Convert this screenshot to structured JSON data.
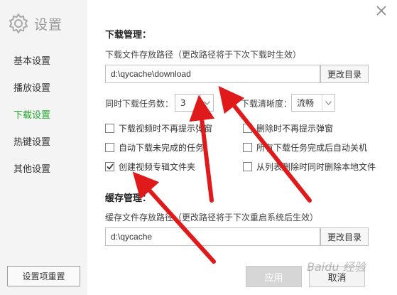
{
  "sidebar": {
    "brand_label": "设置",
    "items": [
      {
        "label": "基本设置"
      },
      {
        "label": "播放设置"
      },
      {
        "label": "下载设置"
      },
      {
        "label": "热键设置"
      },
      {
        "label": "其他设置"
      }
    ],
    "active_item": "下载设置",
    "reset_label": "设置项重置"
  },
  "download": {
    "section_title": "下载管理：",
    "path_label": "下载文件存放路径（更改路径将于下次下载时生效）",
    "path_value": "d:\\qycache\\download",
    "change_label": "更改目录",
    "tasks_label": "同时下载任务数：",
    "tasks_value": "3",
    "quality_label": "下载清晰度：",
    "quality_value": "流畅",
    "options": [
      {
        "label": "下载视频时不再提示弹窗",
        "checked": false
      },
      {
        "label": "删除时不再提示弹窗",
        "checked": false
      },
      {
        "label": "自动下载未完成的任务",
        "checked": false
      },
      {
        "label": "所有下载任务完成后自动关机",
        "checked": false
      },
      {
        "label": "创建视频专辑文件夹",
        "checked": true
      },
      {
        "label": "从列表删除时同时删除本地文件",
        "checked": false
      }
    ]
  },
  "cache": {
    "section_title": "缓存管理：",
    "path_label": "缓存文件存放路径（更改路径将于下次重启系统后生效）",
    "path_value": "d:\\qycache",
    "change_label": "更改目录"
  },
  "footer": {
    "apply_label": "应用",
    "cancel_label": "取消"
  },
  "watermark": "Baidu 经验",
  "colors": {
    "active_nav": "#25a930",
    "annotation_arrows": "#e0191b",
    "sidebar_bg": "#f4f4f4"
  },
  "icons": {
    "brand": "gear-icon",
    "close": "close-icon",
    "dropdown": "chevron-down-icon",
    "check": "checkmark-icon"
  }
}
